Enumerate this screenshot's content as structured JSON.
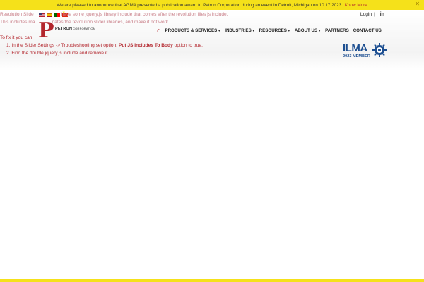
{
  "announcement": {
    "text": "We are pleased to announce that AGMA presented a publication award to Petron Corporation during an event in Detroit, Michigan on 10.17.2023.",
    "link_label": "Know More",
    "close_glyph": "✕"
  },
  "header": {
    "logo": {
      "letter": "P",
      "name": "PETRON",
      "suffix": "CORPORATION"
    },
    "login_label": "Login",
    "separator": "|",
    "linkedin_label": "in",
    "nav": {
      "home_icon": "⌂",
      "items": [
        {
          "label": "PRODUCTS & SERVICES",
          "dropdown": true
        },
        {
          "label": "INDUSTRIES",
          "dropdown": true
        },
        {
          "label": "RESOURCES",
          "dropdown": true
        },
        {
          "label": "ABOUT US",
          "dropdown": true
        },
        {
          "label": "PARTNERS",
          "dropdown": false
        },
        {
          "label": "CONTACT US",
          "dropdown": false
        }
      ],
      "caret": "▼"
    },
    "badge": {
      "word": "ILMA",
      "member": "2023 MEMBER"
    }
  },
  "error_message": {
    "line1_a": "Revolution Slide",
    "line1_b": "have some jquery.js library include that comes after the revolution files js include.",
    "line2_a": "This includes ma",
    "line2_b": "nates the revolution slider libraries, and make it not work.",
    "line3": "To fix it you can:",
    "step1_prefix": "1. In the Slider Settings -> Troubleshooting set option:",
    "step1_strong": "Put JS Includes To Body",
    "step1_suffix": "option to true.",
    "step2": "2. Find the double jquery.js include and remove it."
  },
  "colors": {
    "announcement_bg": "#f5e11a",
    "brand_red": "#b3262d",
    "ilma_blue": "#1d4f91"
  }
}
